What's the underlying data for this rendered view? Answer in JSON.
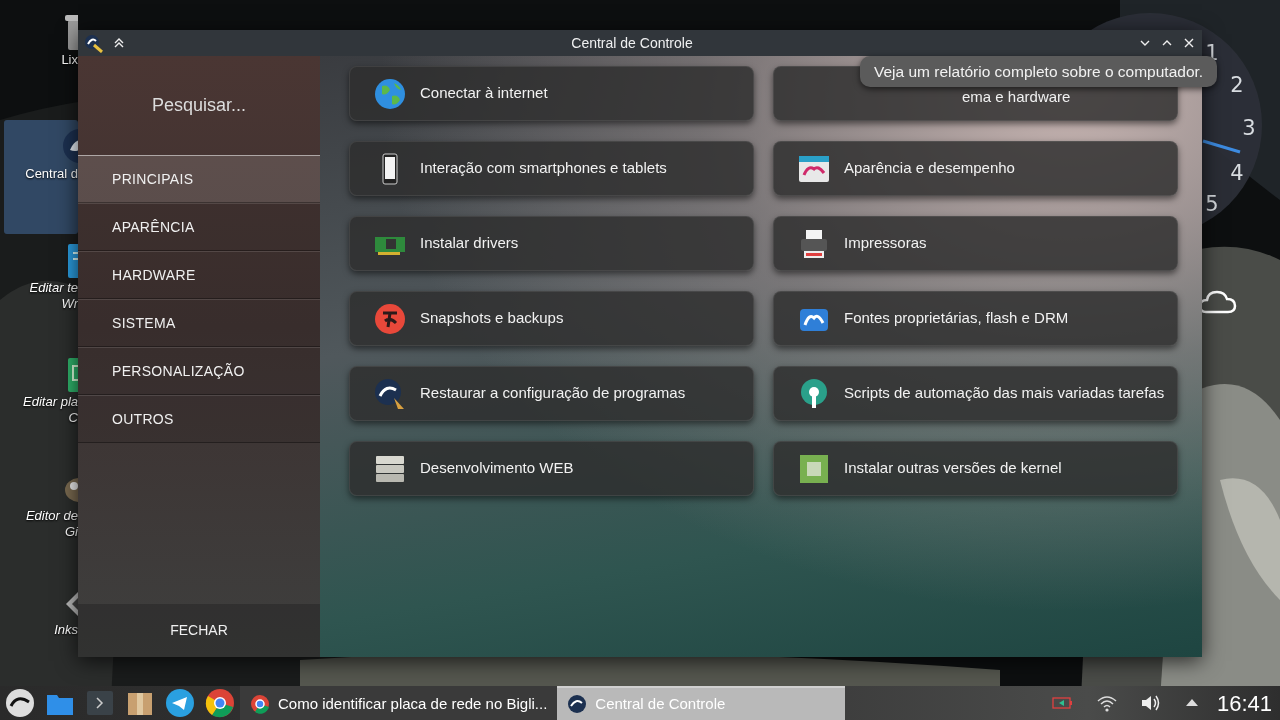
{
  "desktop_icons": [
    {
      "lines": [
        "Lix"
      ],
      "italic": false,
      "selected": false
    },
    {
      "lines": [
        "Central d"
      ],
      "italic": false,
      "selected": true
    },
    {
      "lines": [
        "Editar te",
        "Wr"
      ],
      "italic": true,
      "selected": false
    },
    {
      "lines": [
        "Editar pla",
        "C"
      ],
      "italic": true,
      "selected": false
    },
    {
      "lines": [
        "Editor de",
        "Gi"
      ],
      "italic": true,
      "selected": false
    },
    {
      "lines": [
        "Inks"
      ],
      "italic": true,
      "selected": false
    }
  ],
  "clock_widget": {
    "numerals": [
      "1",
      "2",
      "3",
      "4",
      "5"
    ]
  },
  "window": {
    "title": "Central de Controle",
    "search": {
      "placeholder": "Pesquisar..."
    },
    "categories": [
      {
        "label": "PRINCIPAIS",
        "selected": true
      },
      {
        "label": "APARÊNCIA",
        "selected": false
      },
      {
        "label": "HARDWARE",
        "selected": false
      },
      {
        "label": "SISTEMA",
        "selected": false
      },
      {
        "label": "PERSONALIZAÇÃO",
        "selected": false
      },
      {
        "label": "OUTROS",
        "selected": false
      }
    ],
    "close_label": "FECHAR",
    "cards": [
      {
        "label": "Conectar à internet",
        "covered": false
      },
      {
        "label": "ema e hardware",
        "covered": true
      },
      {
        "label": "Interação com smartphones e tablets",
        "covered": false
      },
      {
        "label": "Aparência e desempenho",
        "covered": false
      },
      {
        "label": "Instalar drivers",
        "covered": false
      },
      {
        "label": "Impressoras",
        "covered": false
      },
      {
        "label": "Snapshots e backups",
        "covered": false
      },
      {
        "label": "Fontes proprietárias, flash e DRM",
        "covered": false
      },
      {
        "label": "Restaurar a configuração de programas",
        "covered": false
      },
      {
        "label": "Scripts de automação das mais variadas tarefas",
        "covered": false
      },
      {
        "label": "Desenvolvimento WEB",
        "covered": false
      },
      {
        "label": "Instalar outras versões de kernel",
        "covered": false
      }
    ],
    "tooltip": "Veja um relatório completo sobre o computador."
  },
  "taskbar": {
    "tasks": [
      {
        "label": "Como identificar placa de rede no Bigli...",
        "selected": false
      },
      {
        "label": "Central de Controle",
        "selected": true
      }
    ],
    "clock": "16:41"
  }
}
